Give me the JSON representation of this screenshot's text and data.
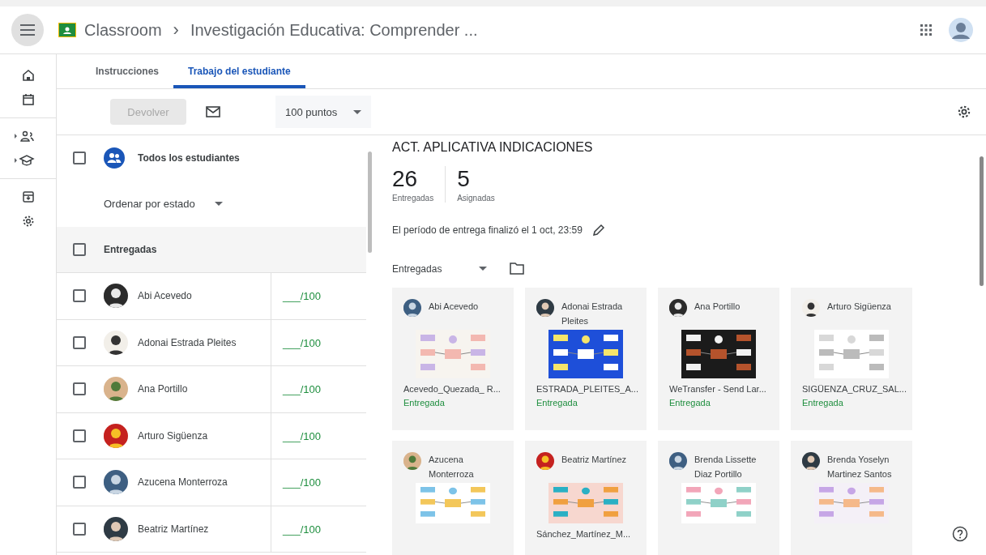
{
  "header": {
    "app_name": "Classroom",
    "separator": "›",
    "title": "Investigación Educativa: Comprender ..."
  },
  "tabs": [
    {
      "label": "Instrucciones",
      "selected": false
    },
    {
      "label": "Trabajo del estudiante",
      "selected": true
    }
  ],
  "toolbar": {
    "return_button": {
      "label": "Devolver",
      "disabled": true
    },
    "points": "100 puntos"
  },
  "student_list": {
    "all_label": "Todos los estudiantes",
    "all_checked": false,
    "sort_label": "Ordenar por estado",
    "groups": [
      {
        "label": "Entregadas",
        "checked": false,
        "students": [
          {
            "name": "Abi Acevedo",
            "grade": "___/100",
            "checked": false
          },
          {
            "name": "Adonai Estrada Pleites",
            "grade": "___/100",
            "checked": false
          },
          {
            "name": "Ana Portillo",
            "grade": "___/100",
            "checked": false
          },
          {
            "name": "Arturo Sigüenza",
            "grade": "___/100",
            "checked": false
          },
          {
            "name": "Azucena Monterroza",
            "grade": "___/100",
            "checked": false
          },
          {
            "name": "Beatriz Martínez",
            "grade": "___/100",
            "checked": false
          }
        ]
      }
    ]
  },
  "assignment": {
    "title": "ACT. APLICATIVA INDICACIONES",
    "stats": [
      {
        "value": "26",
        "label": "Entregadas"
      },
      {
        "value": "5",
        "label": "Asignadas"
      }
    ],
    "due_note": "El período de entrega finalizó el 1 oct, 23:59",
    "filter": "Entregadas",
    "submissions": [
      {
        "name": "Abi Acevedo",
        "file": "Acevedo_Quezada_ R...",
        "status": "Entregada"
      },
      {
        "name": "Adonai Estrada Pleites",
        "file": "ESTRADA_PLEITES_A...",
        "status": "Entregada"
      },
      {
        "name": "Ana Portillo",
        "file": "WeTransfer - Send Lar...",
        "status": "Entregada"
      },
      {
        "name": "Arturo Sigüenza",
        "file": "SIGÜENZA_CRUZ_SAL...",
        "status": "Entregada"
      },
      {
        "name": "Azucena Monterroza"
      },
      {
        "name": "Beatriz Martínez",
        "file": "Sánchez_Martínez_M..."
      },
      {
        "name": "Brenda Lissette Diaz Portillo"
      },
      {
        "name": "Brenda Yoselyn Martinez Santos"
      }
    ]
  }
}
